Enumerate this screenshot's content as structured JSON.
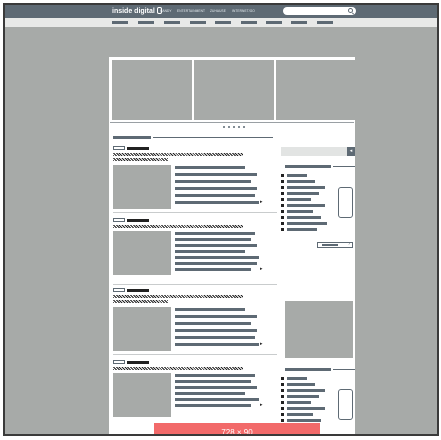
{
  "header": {
    "logo": "inside digital",
    "nav": [
      "HANDY",
      "ENTERTAINMENT",
      "ZUHAUSE",
      "INTERNET/GO"
    ],
    "search": {
      "placeholder": ""
    }
  },
  "subnav": {
    "items": [
      "",
      "",
      "",
      "",
      "",
      "",
      "",
      ""
    ]
  },
  "slider": {
    "slides": 3,
    "dots": 5
  },
  "main": {
    "section_title": "",
    "articles": [
      "",
      "",
      "",
      ""
    ]
  },
  "sidebar": {
    "search_button_icon": "arrow-icon",
    "more_arrow": "›"
  },
  "banner": {
    "label": "728 × 90"
  },
  "colors": {
    "frame_bg": "#a7aaa8",
    "header": "#5e6a74",
    "banner": "#f26a6a"
  }
}
